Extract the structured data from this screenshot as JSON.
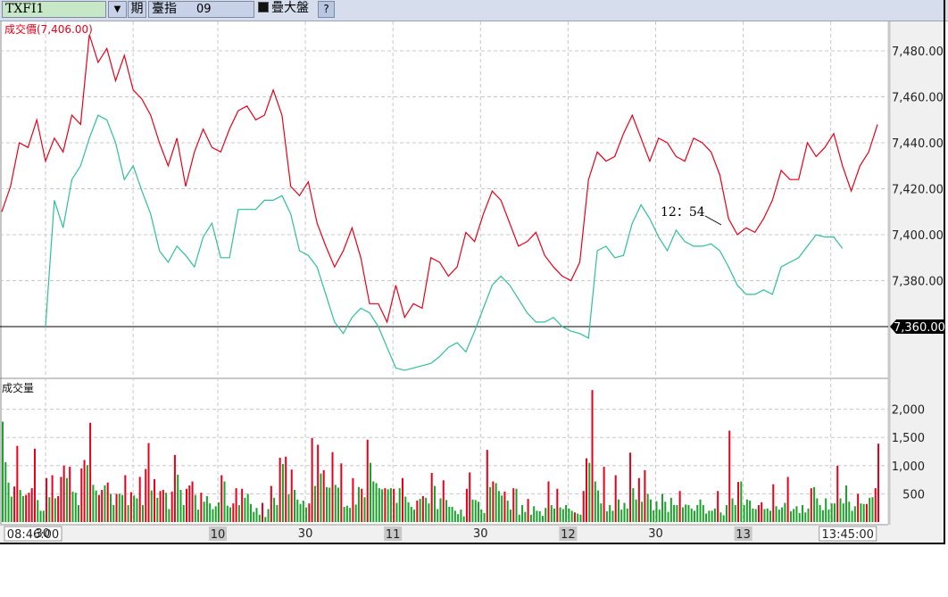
{
  "toolbar": {
    "symbol": "TXFI1",
    "dropdown_icon": "triangle-down",
    "period_label": "期",
    "index_name": "臺指",
    "index_code": "09",
    "overlay_label": "疊大盤",
    "help_label": "?"
  },
  "price_panel": {
    "title": "成交價(7,406.00)",
    "annotation": "12：54",
    "current_marker": "7,360.00"
  },
  "volume_panel": {
    "title": "成交量"
  },
  "colors": {
    "price": "#e8001a",
    "index": "#2fbf9a",
    "vol_up": "#e8001a",
    "vol_down": "#1aa32a"
  },
  "chart_data": [
    {
      "type": "line",
      "title": "成交價(7,406.00)",
      "y_ticks": [
        "7,480.00",
        "7,460.00",
        "7,440.00",
        "7,420.00",
        "7,400.00",
        "7,380.00"
      ],
      "y_tick_values": [
        7480,
        7460,
        7440,
        7420,
        7400,
        7380
      ],
      "reference_value": 7360,
      "ylim": [
        7340,
        7492
      ],
      "x_ticks": [
        {
          "label": "08:46:00",
          "minute": 0,
          "style": "boxed"
        },
        {
          "label": "30",
          "minute": 14,
          "style": "plain"
        },
        {
          "label": "10",
          "minute": 74,
          "style": "hour"
        },
        {
          "label": "30",
          "minute": 104,
          "style": "plain"
        },
        {
          "label": "11",
          "minute": 134,
          "style": "hour"
        },
        {
          "label": "30",
          "minute": 164,
          "style": "plain"
        },
        {
          "label": "12",
          "minute": 194,
          "style": "hour"
        },
        {
          "label": "30",
          "minute": 224,
          "style": "plain"
        },
        {
          "label": "13",
          "minute": 254,
          "style": "hour"
        },
        {
          "label": "13:45:00",
          "minute": 299,
          "style": "boxed"
        }
      ],
      "grid_minutes": [
        15,
        45,
        74,
        104,
        134,
        164,
        194,
        224,
        254,
        284
      ],
      "series": [
        {
          "name": "成交價",
          "color": "#e8001a",
          "start_minute": 0,
          "step_minutes": 3,
          "values": [
            7410,
            7421,
            7440,
            7438,
            7450,
            7432,
            7442,
            7436,
            7452,
            7448,
            7487,
            7475,
            7481,
            7467,
            7478,
            7463,
            7459,
            7452,
            7440,
            7430,
            7442,
            7421,
            7436,
            7446,
            7438,
            7436,
            7446,
            7454,
            7456,
            7450,
            7452,
            7463,
            7452,
            7421,
            7417,
            7423,
            7405,
            7395,
            7386,
            7393,
            7403,
            7390,
            7370,
            7370,
            7362,
            7378,
            7364,
            7370,
            7368,
            7390,
            7388,
            7382,
            7386,
            7401,
            7397,
            7409,
            7419,
            7415,
            7405,
            7395,
            7397,
            7401,
            7391,
            7386,
            7382,
            7380,
            7388,
            7424,
            7436,
            7432,
            7434,
            7444,
            7452,
            7442,
            7432,
            7442,
            7440,
            7434,
            7432,
            7442,
            7440,
            7436,
            7426,
            7407,
            7400,
            7403,
            7401,
            7407,
            7415,
            7428,
            7424,
            7424,
            7440,
            7434,
            7438,
            7444,
            7430,
            7419,
            7430,
            7436,
            7448
          ]
        },
        {
          "name": "大盤",
          "color": "#2fbf9a",
          "start_minute": 15,
          "step_minutes": 3,
          "values": [
            7360,
            7415,
            7403,
            7424,
            7430,
            7442,
            7452,
            7450,
            7440,
            7424,
            7430,
            7419,
            7409,
            7393,
            7388,
            7395,
            7391,
            7386,
            7399,
            7405,
            7390,
            7390,
            7411,
            7411,
            7411,
            7415,
            7415,
            7417,
            7409,
            7393,
            7391,
            7386,
            7374,
            7362,
            7357,
            7364,
            7368,
            7366,
            7360,
            7351,
            7342,
            7341,
            7342,
            7343,
            7344,
            7347,
            7351,
            7353,
            7349,
            7358,
            7368,
            7378,
            7382,
            7378,
            7372,
            7366,
            7362,
            7362,
            7364,
            7360,
            7358,
            7357,
            7355,
            7393,
            7395,
            7390,
            7391,
            7405,
            7413,
            7407,
            7399,
            7393,
            7402,
            7397,
            7395,
            7395,
            7396,
            7393,
            7386,
            7378,
            7374,
            7374,
            7376,
            7374,
            7386,
            7388,
            7390,
            7395,
            7400,
            7399,
            7399,
            7394
          ]
        }
      ]
    },
    {
      "type": "bar",
      "title": "成交量",
      "y_ticks": [
        "2,000",
        "1,500",
        "1,000",
        "500"
      ],
      "y_tick_values": [
        2000,
        1500,
        1000,
        500
      ],
      "ylim": [
        0,
        2500
      ],
      "note": "one bar per minute; positive = red (up), negative = green (down)",
      "values": [
        -1780,
        -1060,
        -700,
        -450,
        630,
        1350,
        -570,
        -460,
        480,
        520,
        600,
        1300,
        -390,
        -200,
        -200,
        780,
        -440,
        830,
        -420,
        460,
        800,
        1000,
        -780,
        980,
        -540,
        -520,
        -300,
        950,
        1100,
        -1010,
        1760,
        -660,
        -560,
        480,
        570,
        -650,
        700,
        -500,
        -300,
        500,
        -500,
        -480,
        830,
        -300,
        530,
        -470,
        -420,
        800,
        -300,
        940,
        1400,
        -560,
        760,
        -430,
        550,
        570,
        -520,
        -230,
        540,
        1190,
        -840,
        -570,
        -300,
        590,
        650,
        720,
        -480,
        -220,
        520,
        -360,
        -460,
        -330,
        -230,
        -280,
        -350,
        830,
        -720,
        -290,
        -260,
        330,
        600,
        -300,
        590,
        -430,
        -500,
        -320,
        -180,
        -250,
        -130,
        340,
        -90,
        -230,
        640,
        -430,
        -300,
        1140,
        -1030,
        1160,
        -490,
        930,
        -570,
        -400,
        -320,
        -380,
        -260,
        330,
        1490,
        -640,
        1370,
        -860,
        920,
        -620,
        -610,
        1240,
        -660,
        -610,
        1040,
        -270,
        -290,
        -250,
        780,
        -310,
        -620,
        590,
        -440,
        1460,
        -1050,
        -720,
        -690,
        -600,
        -580,
        600,
        -580,
        -600,
        590,
        -340,
        -600,
        780,
        -450,
        -350,
        -270,
        -220,
        380,
        -410,
        460,
        -430,
        -330,
        870,
        -640,
        -230,
        -420,
        740,
        -390,
        -270,
        -270,
        -200,
        -140,
        -220,
        -100,
        590,
        880,
        -400,
        -390,
        -360,
        -220,
        -160,
        1280,
        -620,
        720,
        -690,
        -550,
        -470,
        540,
        -380,
        -220,
        600,
        -590,
        -130,
        -300,
        -180,
        410,
        -130,
        -280,
        -200,
        -190,
        -110,
        -250,
        720,
        -300,
        -240,
        590,
        -260,
        -230,
        -300,
        -240,
        -200,
        170,
        -150,
        -130,
        550,
        1130,
        -1050,
        2340,
        -720,
        -560,
        -330,
        980,
        -190,
        -300,
        -200,
        830,
        -400,
        -220,
        -340,
        -240,
        1230,
        -600,
        -400,
        780,
        -360,
        920,
        -500,
        -400,
        -210,
        -370,
        -220,
        -500,
        -360,
        -180,
        -430,
        -300,
        -300,
        550,
        -260,
        -310,
        -300,
        -240,
        -200,
        -300,
        -400,
        -300,
        -150,
        -200,
        -200,
        -240,
        550,
        -170,
        -120,
        -300,
        1620,
        -420,
        -300,
        710,
        -720,
        -300,
        -400,
        -380,
        -240,
        -230,
        300,
        350,
        -230,
        -240,
        -200,
        670,
        -280,
        -220,
        -260,
        -340,
        800,
        -190,
        -230,
        -280,
        -160,
        -300,
        -170,
        -240,
        600,
        -620,
        -420,
        -300,
        -210,
        -420,
        -220,
        -330,
        -330,
        1000,
        -420,
        -330,
        -650,
        -360,
        -200,
        -280,
        500,
        -330,
        -320,
        320,
        -430,
        -440,
        600,
        1390
      ]
    }
  ]
}
